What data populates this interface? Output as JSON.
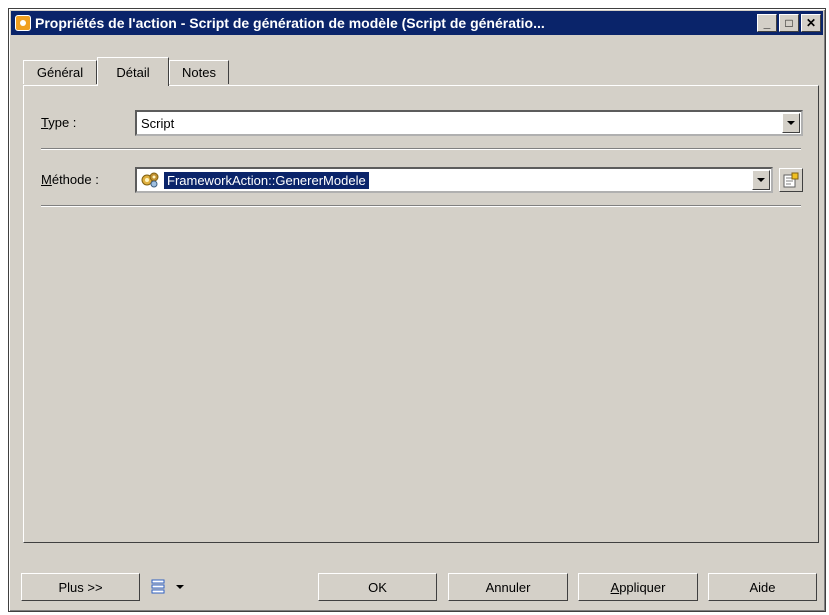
{
  "window": {
    "title": "Propriétés de l'action - Script de génération de modèle (Script de génératio...",
    "minimize_glyph": "_",
    "maximize_glyph": "□",
    "close_glyph": "✕"
  },
  "tabs": [
    {
      "label": "Général",
      "active": false
    },
    {
      "label": "Détail",
      "active": true
    },
    {
      "label": "Notes",
      "active": false
    }
  ],
  "detail": {
    "type_label_first": "T",
    "type_label_rest": "ype :",
    "type_value": "Script",
    "method_label_first": "M",
    "method_label_rest": "éthode :",
    "method_value": "FrameworkAction::GenererModele",
    "method_icon": "gears-icon",
    "properties_icon": "properties-icon"
  },
  "footer": {
    "more_label": "Plus >>",
    "ok_label": "OK",
    "cancel_label": "Annuler",
    "apply_first": "A",
    "apply_rest": "ppliquer",
    "help_label": "Aide"
  },
  "colors": {
    "titlebar": "#0a246a",
    "dialog_face": "#d4d0c8",
    "selection": "#0a246a"
  }
}
